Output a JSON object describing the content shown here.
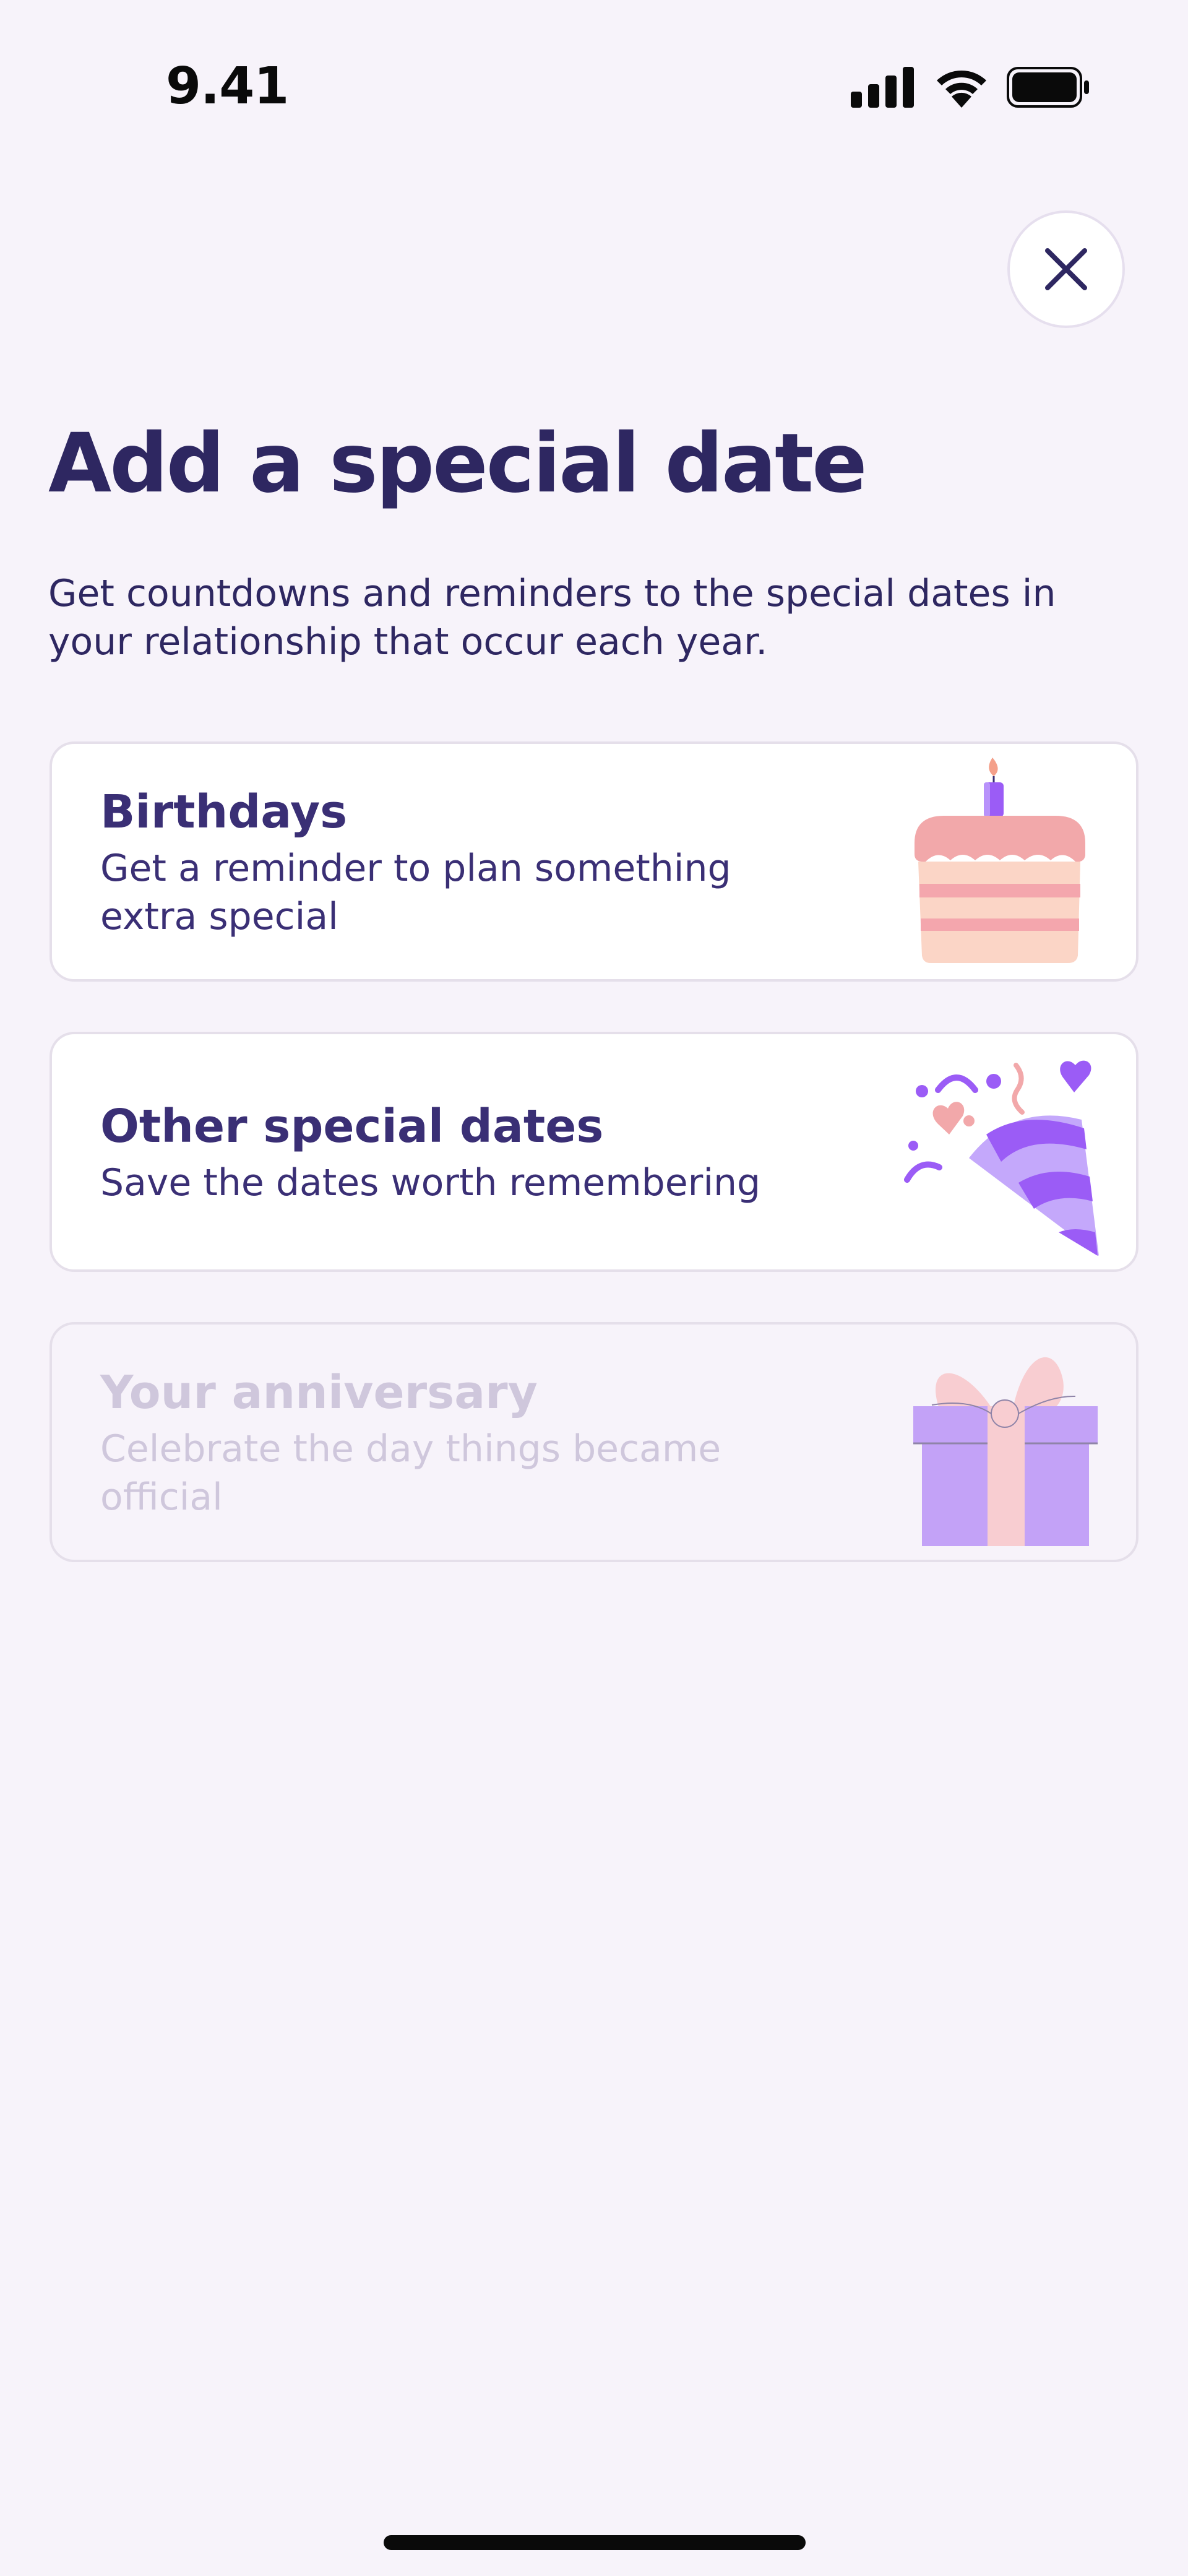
{
  "status_bar": {
    "time": "9.41",
    "icons": [
      "cellular-signal-icon",
      "wifi-icon",
      "battery-icon"
    ]
  },
  "header": {
    "close_icon": "close-icon"
  },
  "main": {
    "title": "Add a special date",
    "subtitle": "Get countdowns and reminders to the special dates in your relationship that occur each year.",
    "cards": [
      {
        "title": "Birthdays",
        "description": "Get a reminder to plan something extra special",
        "illustration": "birthday-cake-icon",
        "enabled": true
      },
      {
        "title": "Other special dates",
        "description": "Save the dates worth remembering",
        "illustration": "party-popper-icon",
        "enabled": true
      },
      {
        "title": "Your anniversary",
        "description": "Celebrate the day things became official",
        "illustration": "gift-box-icon",
        "enabled": false
      }
    ]
  },
  "colors": {
    "background": "#f7f3fa",
    "text_primary": "#2e2761",
    "card_border": "#e5dfea",
    "disabled_text": "#cfc7dc",
    "accent_purple": "#9b5cf6"
  }
}
